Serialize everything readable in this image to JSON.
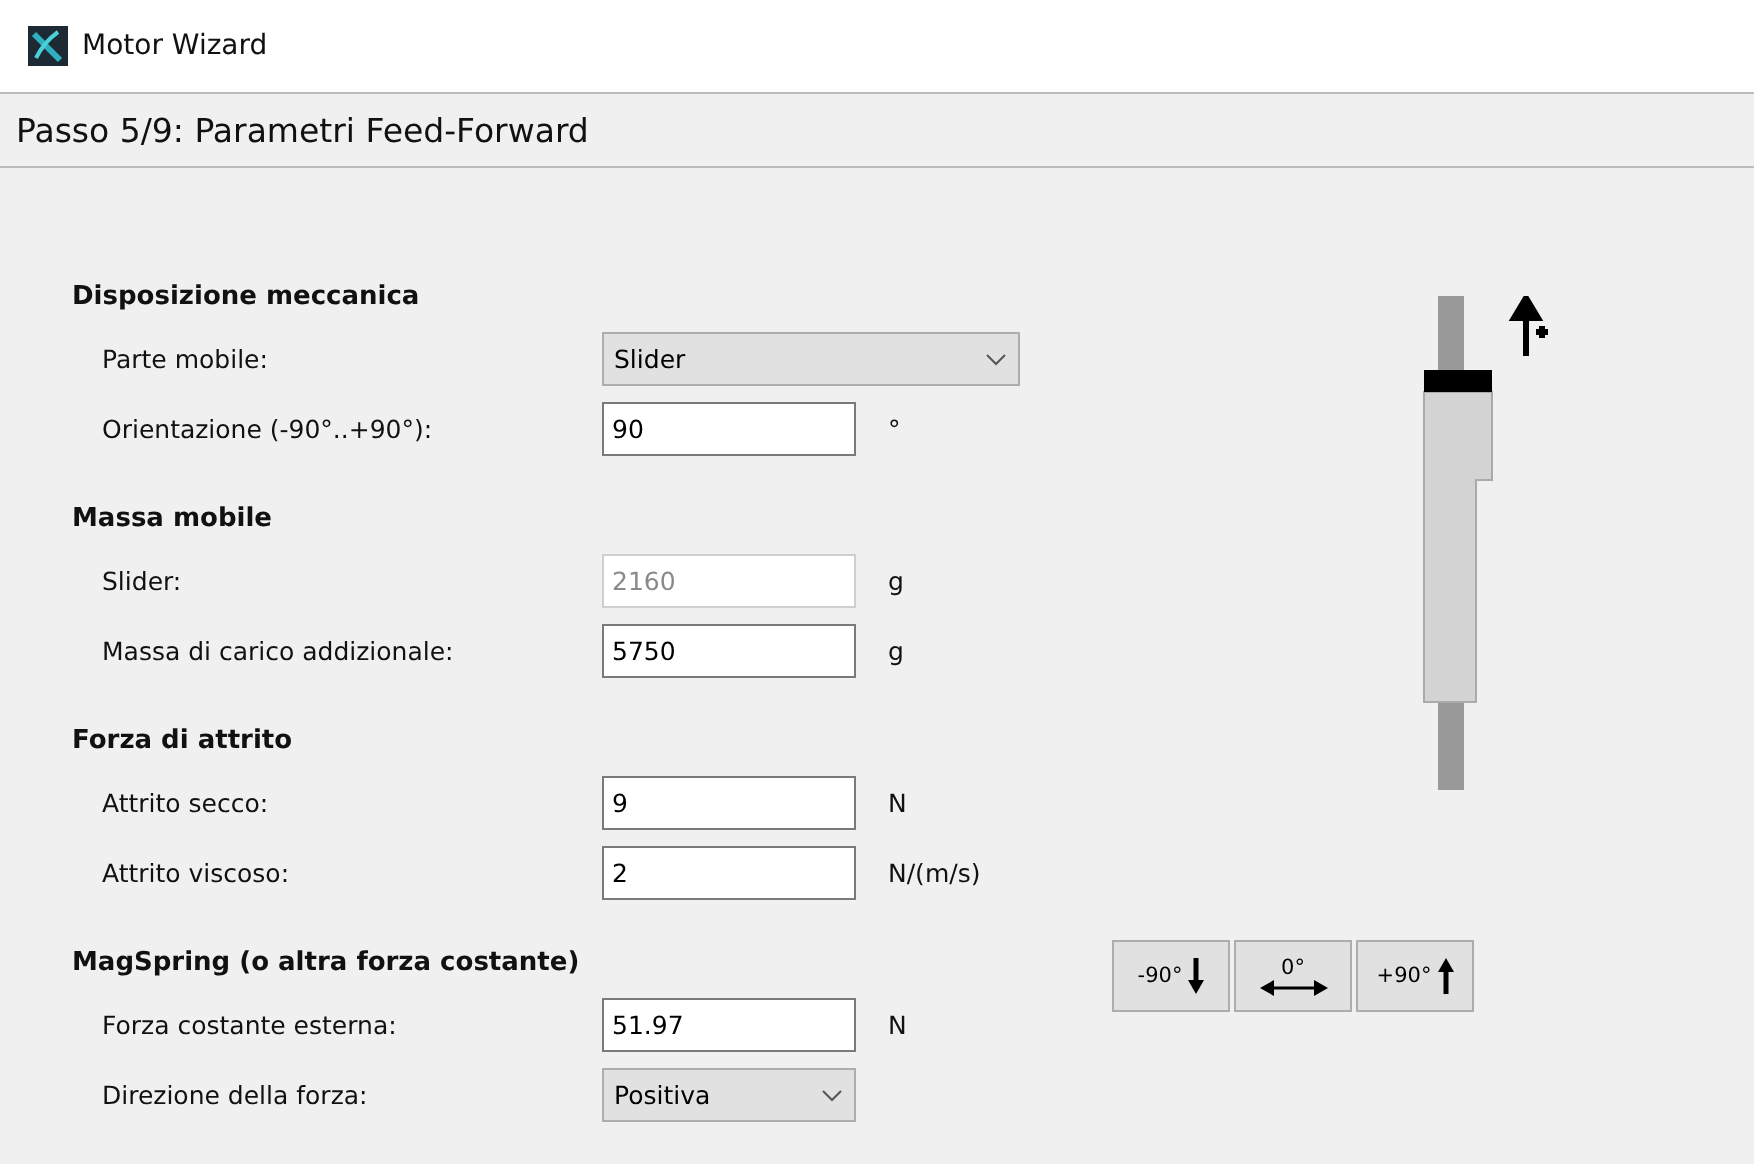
{
  "window": {
    "title": "Motor Wizard"
  },
  "step_title": "Passo 5/9: Parametri Feed-Forward",
  "sections": [
    {
      "title": "Disposizione meccanica",
      "fields": [
        {
          "label": "Parte mobile:",
          "kind": "dropdown",
          "value": "Slider",
          "disabled": false
        },
        {
          "label": "Orientazione (-90°..+90°):",
          "kind": "text",
          "value": "90",
          "unit": "°",
          "disabled": false
        }
      ]
    },
    {
      "title": "Massa mobile",
      "fields": [
        {
          "label": "Slider:",
          "kind": "text",
          "value": "2160",
          "unit": "g",
          "disabled": true
        },
        {
          "label": "Massa di carico addizionale:",
          "kind": "text",
          "value": "5750",
          "unit": "g",
          "disabled": false
        }
      ]
    },
    {
      "title": "Forza di attrito",
      "fields": [
        {
          "label": "Attrito secco:",
          "kind": "text",
          "value": "9",
          "unit": "N",
          "disabled": false
        },
        {
          "label": "Attrito viscoso:",
          "kind": "text",
          "value": "2",
          "unit": "N/(m/s)",
          "disabled": false
        }
      ]
    },
    {
      "title": "MagSpring (o altra forza costante)",
      "fields": [
        {
          "label": "Forza costante esterna:",
          "kind": "text",
          "value": "51.97",
          "unit": "N",
          "disabled": false
        },
        {
          "label": "Direzione della forza:",
          "kind": "short-dropdown",
          "value": "Positiva",
          "disabled": false
        }
      ]
    }
  ],
  "orientation_buttons": [
    {
      "label": "-90°",
      "kind": "down"
    },
    {
      "label": "0°",
      "kind": "horizontal"
    },
    {
      "label": "+90°",
      "kind": "up"
    }
  ]
}
